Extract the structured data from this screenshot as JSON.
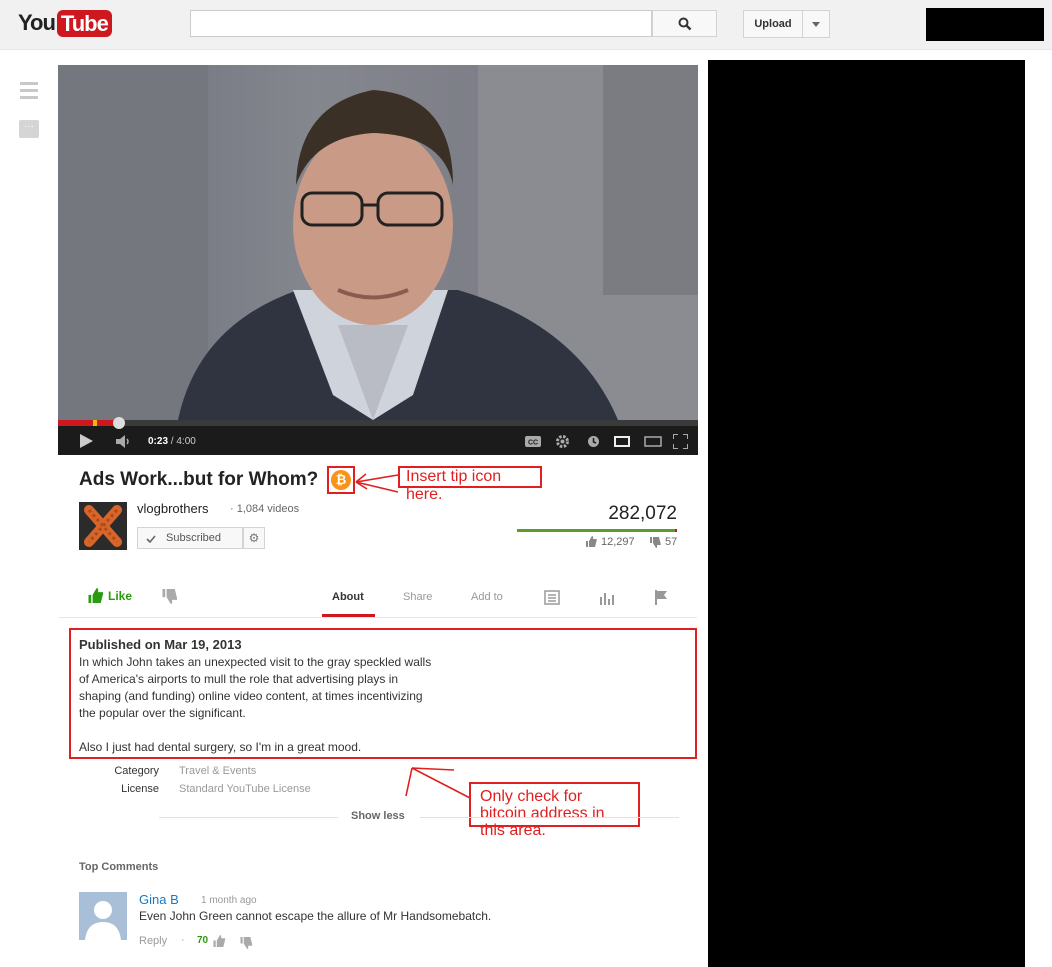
{
  "header": {
    "logo_you": "You",
    "logo_tube": "Tube",
    "search_placeholder": "",
    "upload_label": "Upload"
  },
  "player": {
    "current_time": "0:23",
    "duration": "/ 4:00",
    "progress": 0.096
  },
  "video": {
    "title": "Ads Work...but for Whom?",
    "channel": "vlogbrothers",
    "video_count": "· 1,084 videos",
    "subscribe_label": "Subscribed",
    "views": "282,072",
    "likes": "12,297",
    "dislikes": "57"
  },
  "actions": {
    "like_label": "Like",
    "tabs": [
      "About",
      "Share",
      "Add to"
    ]
  },
  "description": {
    "published": "Published on Mar 19, 2013",
    "text": "In which John takes an unexpected visit to the gray speckled walls\nof America's airports to mull the role that advertising plays in\nshaping (and funding) online video content, at times incentivizing\nthe popular over the significant.\n\nAlso I just had dental surgery, so I'm in a great mood.",
    "category_label": "Category",
    "category_value": "Travel & Events",
    "license_label": "License",
    "license_value": "Standard YouTube License",
    "show_less": "Show less"
  },
  "annotations": {
    "tip_icon": "Insert tip icon here.",
    "check_area": "Only check for bitcoin address in this area.",
    "btc_symbol": "₿"
  },
  "comments": {
    "header": "Top Comments",
    "items": [
      {
        "author": "Gina B",
        "time": "1 month ago",
        "text": "Even John Green cannot escape the allure of Mr Handsomebatch.",
        "reply": "Reply",
        "votes": "70"
      }
    ]
  },
  "colors": {
    "accent": "#cc181e",
    "annotation": "#e02020",
    "bitcoin": "#f7931a",
    "like": "#2b9a0e"
  }
}
